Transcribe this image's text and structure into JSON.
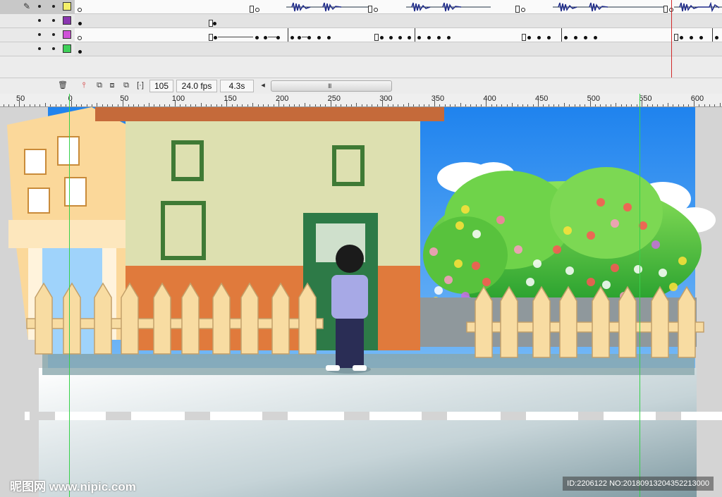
{
  "timeline": {
    "layers": [
      {
        "color": "#f4f06a",
        "active": true
      },
      {
        "color": "#8a36b0",
        "active": false
      },
      {
        "color": "#cf52d8",
        "active": false
      },
      {
        "color": "#3fd05a",
        "active": false
      }
    ]
  },
  "toolbar": {
    "frame": "105",
    "fps": "24.0 fps",
    "time": "4.3s",
    "scroll_arrow": "◂",
    "scroll_grip": "III"
  },
  "ruler": {
    "labels": [
      "50",
      "0",
      "50",
      "100",
      "150",
      "200",
      "250",
      "300",
      "350",
      "400",
      "450",
      "500",
      "550",
      "600"
    ]
  },
  "stage": {
    "sky_color": "#2d8ff0",
    "wall_color": "#dde0b0",
    "roof_color": "#c56a3a",
    "door_color": "#2d7a47"
  },
  "watermark": {
    "left": "昵图网 www.nipic.com",
    "right": "ID:2206122 NO:20180913204352213000"
  },
  "icons": {
    "pencil": "pencil-icon",
    "trash": "trash-icon",
    "onion": "onion-skin-icon"
  }
}
